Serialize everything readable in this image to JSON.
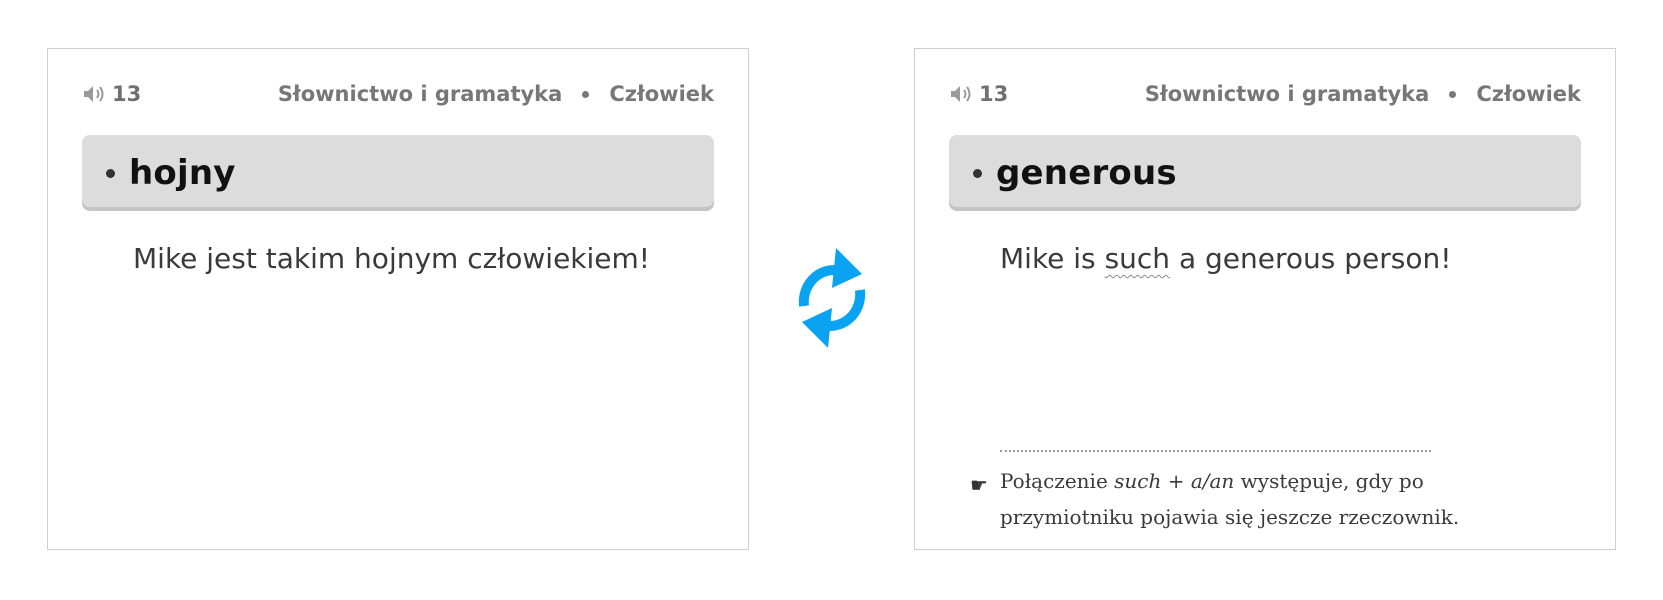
{
  "front_card": {
    "audio_count": "13",
    "category": "Słownictwo i gramatyka",
    "topic": "Człowiek",
    "headword": "hojny",
    "example": "Mike jest takim hojnym człowiekiem!"
  },
  "back_card": {
    "audio_count": "13",
    "category": "Słownictwo i gramatyka",
    "topic": "Człowiek",
    "headword": "generous",
    "example_before": "Mike is ",
    "example_highlight": "such",
    "example_after": " a generous person!",
    "note_part1": "Połączenie ",
    "note_italic": "such + a/an",
    "note_part2": " występuje, gdy po przymiotniku pojawia się jeszcze rzeczownik."
  },
  "icons": {
    "audio": "speaker-icon",
    "swap": "refresh-arrows-icon",
    "note": "pointing-hand-icon"
  },
  "colors": {
    "accent": "#0aa3f2",
    "headword_bg": "#dcdcdc"
  }
}
